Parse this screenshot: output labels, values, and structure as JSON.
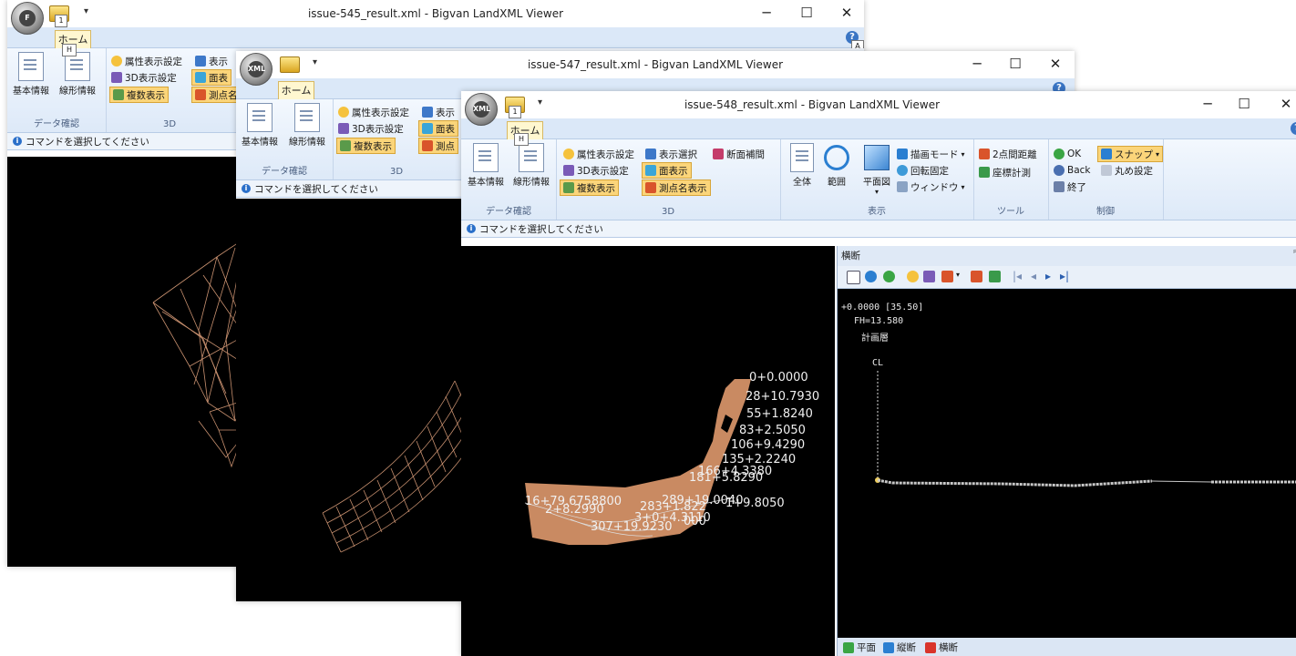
{
  "ribbon_labels": {
    "tab_home": "ホーム",
    "key_tip_h": "H",
    "key_tip_a": "A",
    "key_tip_f": "F",
    "key_tip_1": "1",
    "basic_info": "基本情報",
    "alignment_info": "線形情報",
    "group_data_check": "データ確認",
    "attr_display_settings": "属性表示設定",
    "display_select": "表示選択",
    "section_interp": "断面補間",
    "settings_3d": "3D表示設定",
    "face_display": "面表示",
    "multi_display": "複数表示",
    "point_name_display": "測点名表示",
    "group_3d": "3D",
    "all": "全体",
    "range": "範囲",
    "plan_view": "平面図",
    "draw_mode": "描画モード",
    "rotation_lock": "回転固定",
    "window": "ウィンドウ",
    "group_view": "表示",
    "two_point_distance": "2点間距離",
    "coord_measure": "座標計測",
    "group_tools": "ツール",
    "ok": "OK",
    "snap": "スナップ",
    "back": "Back",
    "rounding_settings": "丸め設定",
    "exit": "終了",
    "group_control": "制御",
    "truncated_display": "表示",
    "truncated_face": "面表",
    "truncated_point": "測点名",
    "truncated_point2": "測点"
  },
  "status_text": "コマンドを選択してください",
  "windows": [
    {
      "id": "win1",
      "title": "issue-545_result.xml - Bigvan LandXML Viewer"
    },
    {
      "id": "win2",
      "title": "issue-547_result.xml - Bigvan LandXML Viewer"
    },
    {
      "id": "win3",
      "title": "issue-548_result.xml - Bigvan LandXML Viewer"
    }
  ],
  "window_controls": {
    "minimize": "─",
    "maximize": "☐",
    "close": "✕"
  },
  "station_labels": [
    "0+0.0000",
    "28+10.7930",
    "55+1.8240",
    "83+2.5050",
    "106+9.4290",
    "135+2.2240",
    "166+4.3380",
    "181+5.8290",
    "16+79.6758800",
    "289+19.0040",
    "2+8.2990",
    "283+1.822",
    "1+9.8050",
    "3+0+4.3110",
    "307+19.9230",
    "000"
  ],
  "cross_section_panel": {
    "title": "横断",
    "pin": "ᵖ",
    "station_readout": "+0.0000 [35.50]",
    "fh_label": "FH=13.580",
    "layer_label": "計画層",
    "cl_label": "CL"
  },
  "bottom_tabs": {
    "plan": "平面",
    "profile": "縦断",
    "cross": "横断"
  },
  "colors": {
    "ribbon_bg": "#dde9f8",
    "active_button": "#fbd57a",
    "surface_fill": "#c98a62",
    "wireframe": "#c99170",
    "label_text": "#f0f0f0",
    "viewport_bg": "#000000"
  }
}
